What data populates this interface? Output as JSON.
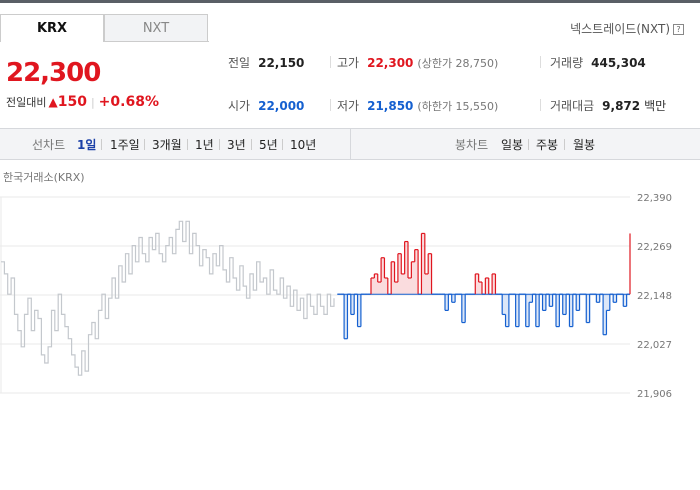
{
  "tabs": [
    {
      "label": "KRX",
      "active": true
    },
    {
      "label": "NXT",
      "active": false
    }
  ],
  "nxt_link": {
    "label": "넥스트레이드(NXT)",
    "help": "?"
  },
  "quote": {
    "price": "22,300",
    "change_label": "전일대비",
    "change_arrow": "▲",
    "change_value": "150",
    "change_pct": "+0.68%"
  },
  "stats": {
    "prev_close": {
      "label": "전일",
      "value": "22,150"
    },
    "high": {
      "label": "고가",
      "value": "22,300",
      "sub": "(상한가 28,750)"
    },
    "volume": {
      "label": "거래량",
      "value": "445,304"
    },
    "open": {
      "label": "시가",
      "value": "22,000"
    },
    "low": {
      "label": "저가",
      "value": "21,850",
      "sub": "(하한가 15,550)"
    },
    "amount": {
      "label": "거래대금",
      "value": "9,872",
      "unit": "백만"
    }
  },
  "periods": {
    "line_label": "선차트",
    "line_items": [
      {
        "label": "1일",
        "active": true
      },
      {
        "label": "1주일",
        "active": false
      },
      {
        "label": "3개월",
        "active": false
      },
      {
        "label": "1년",
        "active": false
      },
      {
        "label": "3년",
        "active": false
      },
      {
        "label": "5년",
        "active": false
      },
      {
        "label": "10년",
        "active": false
      }
    ],
    "candle_label": "봉차트",
    "candle_items": [
      {
        "label": "일봉"
      },
      {
        "label": "주봉"
      },
      {
        "label": "월봉"
      }
    ]
  },
  "chart_title": "한국거래소(KRX)",
  "colors": {
    "up": "#e0161f",
    "down": "#1560d0",
    "prev_session": "#c4c8cd"
  },
  "chart_data": {
    "type": "line",
    "y_ticks": [
      "22,390",
      "22,269",
      "22,148",
      "22,027",
      "21,906"
    ],
    "ylim": [
      21906,
      22390
    ],
    "baseline": 22150,
    "series": [
      {
        "values": [
          22230,
          22200,
          22150,
          22190,
          22100,
          22060,
          22020,
          22100,
          22140,
          22060,
          22110,
          22090,
          22000,
          21980,
          22020,
          22110,
          22060,
          22150,
          22100,
          22070,
          22040,
          22000,
          21970,
          21950,
          22010,
          21960,
          22050,
          22080,
          22040,
          22110,
          22150,
          22090,
          22140,
          22190,
          22140,
          22220,
          22180,
          22250,
          22200,
          22270,
          22230,
          22290,
          22250,
          22230,
          22290,
          22260,
          22300,
          22250,
          22230,
          22270,
          22290,
          22250,
          22310,
          22330,
          22280,
          22330,
          22250,
          22300,
          22270,
          22220,
          22260,
          22240,
          22200,
          22250,
          22220,
          22270,
          22210,
          22180,
          22240,
          22190,
          22160,
          22220,
          22170,
          22140,
          22200,
          22160,
          22230,
          22180,
          22190,
          22150,
          22210,
          22160,
          22150,
          22190,
          22140,
          22170,
          22120,
          22160,
          22110,
          22140,
          22090,
          22150,
          22120,
          22100,
          22150,
          22120,
          22100,
          22150,
          22120,
          22140
        ]
      },
      {
        "values": [
          22150,
          22150,
          22040,
          22150,
          22100,
          22150,
          22070,
          22150,
          22150,
          22150,
          22190,
          22200,
          22180,
          22240,
          22190,
          22150,
          22230,
          22180,
          22250,
          22200,
          22280,
          22190,
          22230,
          22260,
          22150,
          22300,
          22200,
          22250,
          22150,
          22150,
          22150,
          22150,
          22110,
          22150,
          22130,
          22150,
          22150,
          22080,
          22150,
          22150,
          22150,
          22200,
          22180,
          22150,
          22190,
          22150,
          22200,
          22150,
          22150,
          22100,
          22070,
          22150,
          22150,
          22070,
          22150,
          22150,
          22070,
          22130,
          22150,
          22070,
          22150,
          22110,
          22150,
          22120,
          22150,
          22070,
          22150,
          22100,
          22150,
          22070,
          22150,
          22110,
          22150,
          22150,
          22080,
          22150,
          22150,
          22130,
          22150,
          22050,
          22110,
          22150,
          22130,
          22150,
          22150,
          22120,
          22150,
          22300
        ]
      }
    ]
  }
}
